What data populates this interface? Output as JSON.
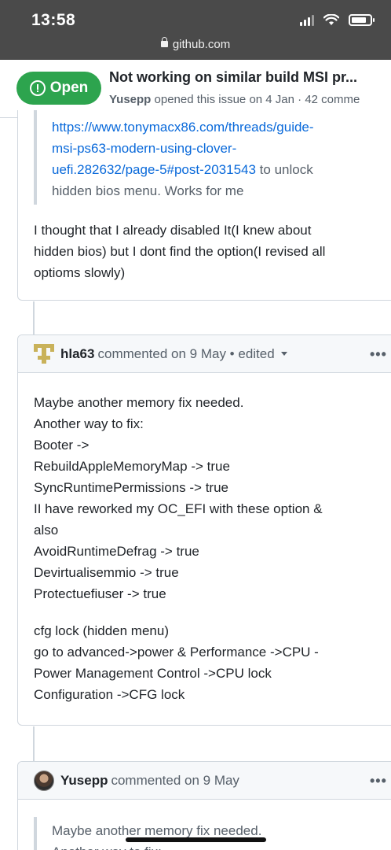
{
  "status_bar": {
    "time": "13:58"
  },
  "browser": {
    "url": "github.com"
  },
  "issue": {
    "state": "Open",
    "title": "Not working on similar build MSI pr...",
    "author": "Yusepp",
    "meta": "opened this issue on 4 Jan · 42 comme"
  },
  "comment1": {
    "quote_link_lines": [
      "https://www.tonymacx86.com/threads/guide-",
      "msi-ps63-modern-using-clover-",
      "uefi.282632/page-5#post-2031543"
    ],
    "quote_tail": " to unlock",
    "quote_last_line": "hidden bios menu. Works for me",
    "body_lines": [
      "I thought that I already disabled It(I knew about",
      "hidden bios) but I dont find the option(I revised all",
      "optioms slowly)"
    ]
  },
  "comment2": {
    "author": "hla63",
    "action": "commented on 9 May",
    "edited": "edited",
    "menu": "•••",
    "para1": [
      "Maybe another memory fix needed.",
      "Another way to fix:",
      "Booter ->",
      "RebuildAppleMemoryMap -> true",
      "SyncRuntimePermissions -> true",
      "II have reworked my OC_EFI with these option &",
      "also",
      "AvoidRuntimeDefrag -> true",
      "Devirtualisemmio -> true",
      "Protectuefiuser -> true"
    ],
    "para2": [
      "cfg lock (hidden menu)",
      "go to advanced->power & Performance ->CPU -",
      "Power Management Control ->CPU lock",
      "Configuration ->CFG lock"
    ]
  },
  "comment3": {
    "author": "Yusepp",
    "action": "commented on 9 May",
    "menu": "•••",
    "quote_lines": [
      "Maybe another memory fix needed.",
      "Another way to fix:"
    ]
  },
  "colors": {
    "open_green": "#2da44e",
    "link_blue": "#0969da",
    "status_bar": "#4a4a4a"
  },
  "icons": [
    "lock-icon",
    "signal-icon",
    "wifi-icon",
    "battery-icon",
    "issue-open-icon",
    "kebab-menu-icon",
    "caret-down-icon"
  ]
}
